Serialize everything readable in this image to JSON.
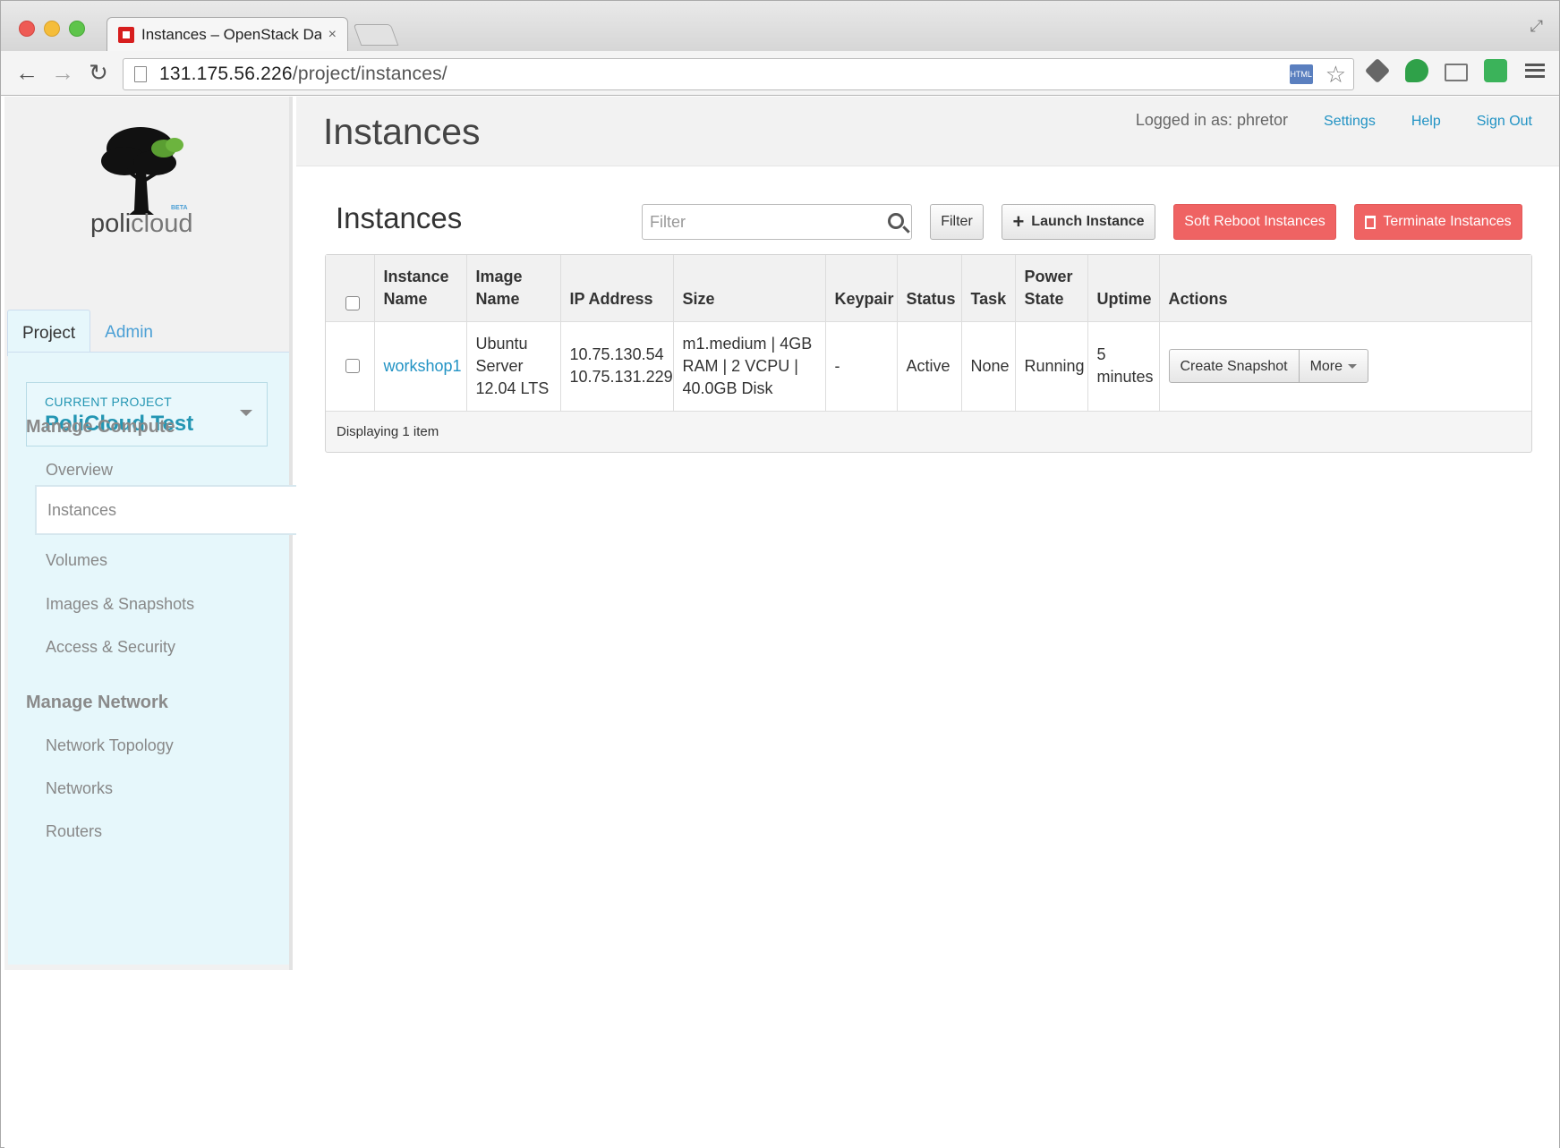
{
  "browser": {
    "tab_title": "Instances – OpenStack Das",
    "tab_close": "×",
    "url_host": "131.175.56.226",
    "url_path": "/project/instances/",
    "back_glyph": "←",
    "forward_glyph": "→",
    "reload_glyph": "↻",
    "star_glyph": "☆",
    "html5_label": "HTML"
  },
  "logo": {
    "text_a": "poli",
    "text_b": "cloud",
    "beta": "BETA"
  },
  "sidebar": {
    "tabs": [
      {
        "label": "Project",
        "active": true
      },
      {
        "label": "Admin",
        "active": false
      }
    ],
    "current_project_label": "CURRENT PROJECT",
    "current_project_name": "PoliCloud Test",
    "sections": [
      {
        "heading": "Manage Compute",
        "items": [
          {
            "label": "Overview"
          },
          {
            "label": "Instances",
            "active": true
          },
          {
            "label": "Volumes"
          },
          {
            "label": "Images & Snapshots"
          },
          {
            "label": "Access & Security"
          }
        ]
      },
      {
        "heading": "Manage Network",
        "items": [
          {
            "label": "Network Topology"
          },
          {
            "label": "Networks"
          },
          {
            "label": "Routers"
          }
        ]
      }
    ]
  },
  "header": {
    "title": "Instances",
    "logged_in": "Logged in as: phretor",
    "links": [
      "Settings",
      "Help",
      "Sign Out"
    ]
  },
  "main": {
    "section_title": "Instances",
    "filter_placeholder": "Filter",
    "filter_button": "Filter",
    "launch_button": "Launch Instance",
    "soft_reboot_button": "Soft Reboot Instances",
    "terminate_button": "Terminate Instances",
    "table": {
      "columns": [
        {
          "line1": "",
          "line2": ""
        },
        {
          "line1": "Instance",
          "line2": "Name"
        },
        {
          "line1": "Image",
          "line2": "Name"
        },
        {
          "line1": "",
          "line2": "IP Address"
        },
        {
          "line1": "",
          "line2": "Size"
        },
        {
          "line1": "",
          "line2": "Keypair"
        },
        {
          "line1": "",
          "line2": "Status"
        },
        {
          "line1": "",
          "line2": "Task"
        },
        {
          "line1": "Power",
          "line2": "State"
        },
        {
          "line1": "",
          "line2": "Uptime"
        },
        {
          "line1": "",
          "line2": "Actions"
        }
      ],
      "rows": [
        {
          "instance_name": "workshop1",
          "image_name": [
            "Ubuntu",
            "Server",
            "12.04 LTS"
          ],
          "ip_address": [
            "10.75.130.54",
            "10.75.131.229"
          ],
          "size": [
            "m1.medium | 4GB",
            "RAM | 2 VCPU |",
            "40.0GB Disk"
          ],
          "keypair": "-",
          "status": "Active",
          "task": "None",
          "power_state": "Running",
          "uptime": [
            "5",
            "minutes"
          ],
          "action_primary": "Create Snapshot",
          "action_more": "More"
        }
      ],
      "footer": "Displaying 1 item"
    }
  },
  "colors": {
    "link": "#2293c4",
    "danger": "#ef6363",
    "sidebar_bg": "#e6f7fb"
  }
}
